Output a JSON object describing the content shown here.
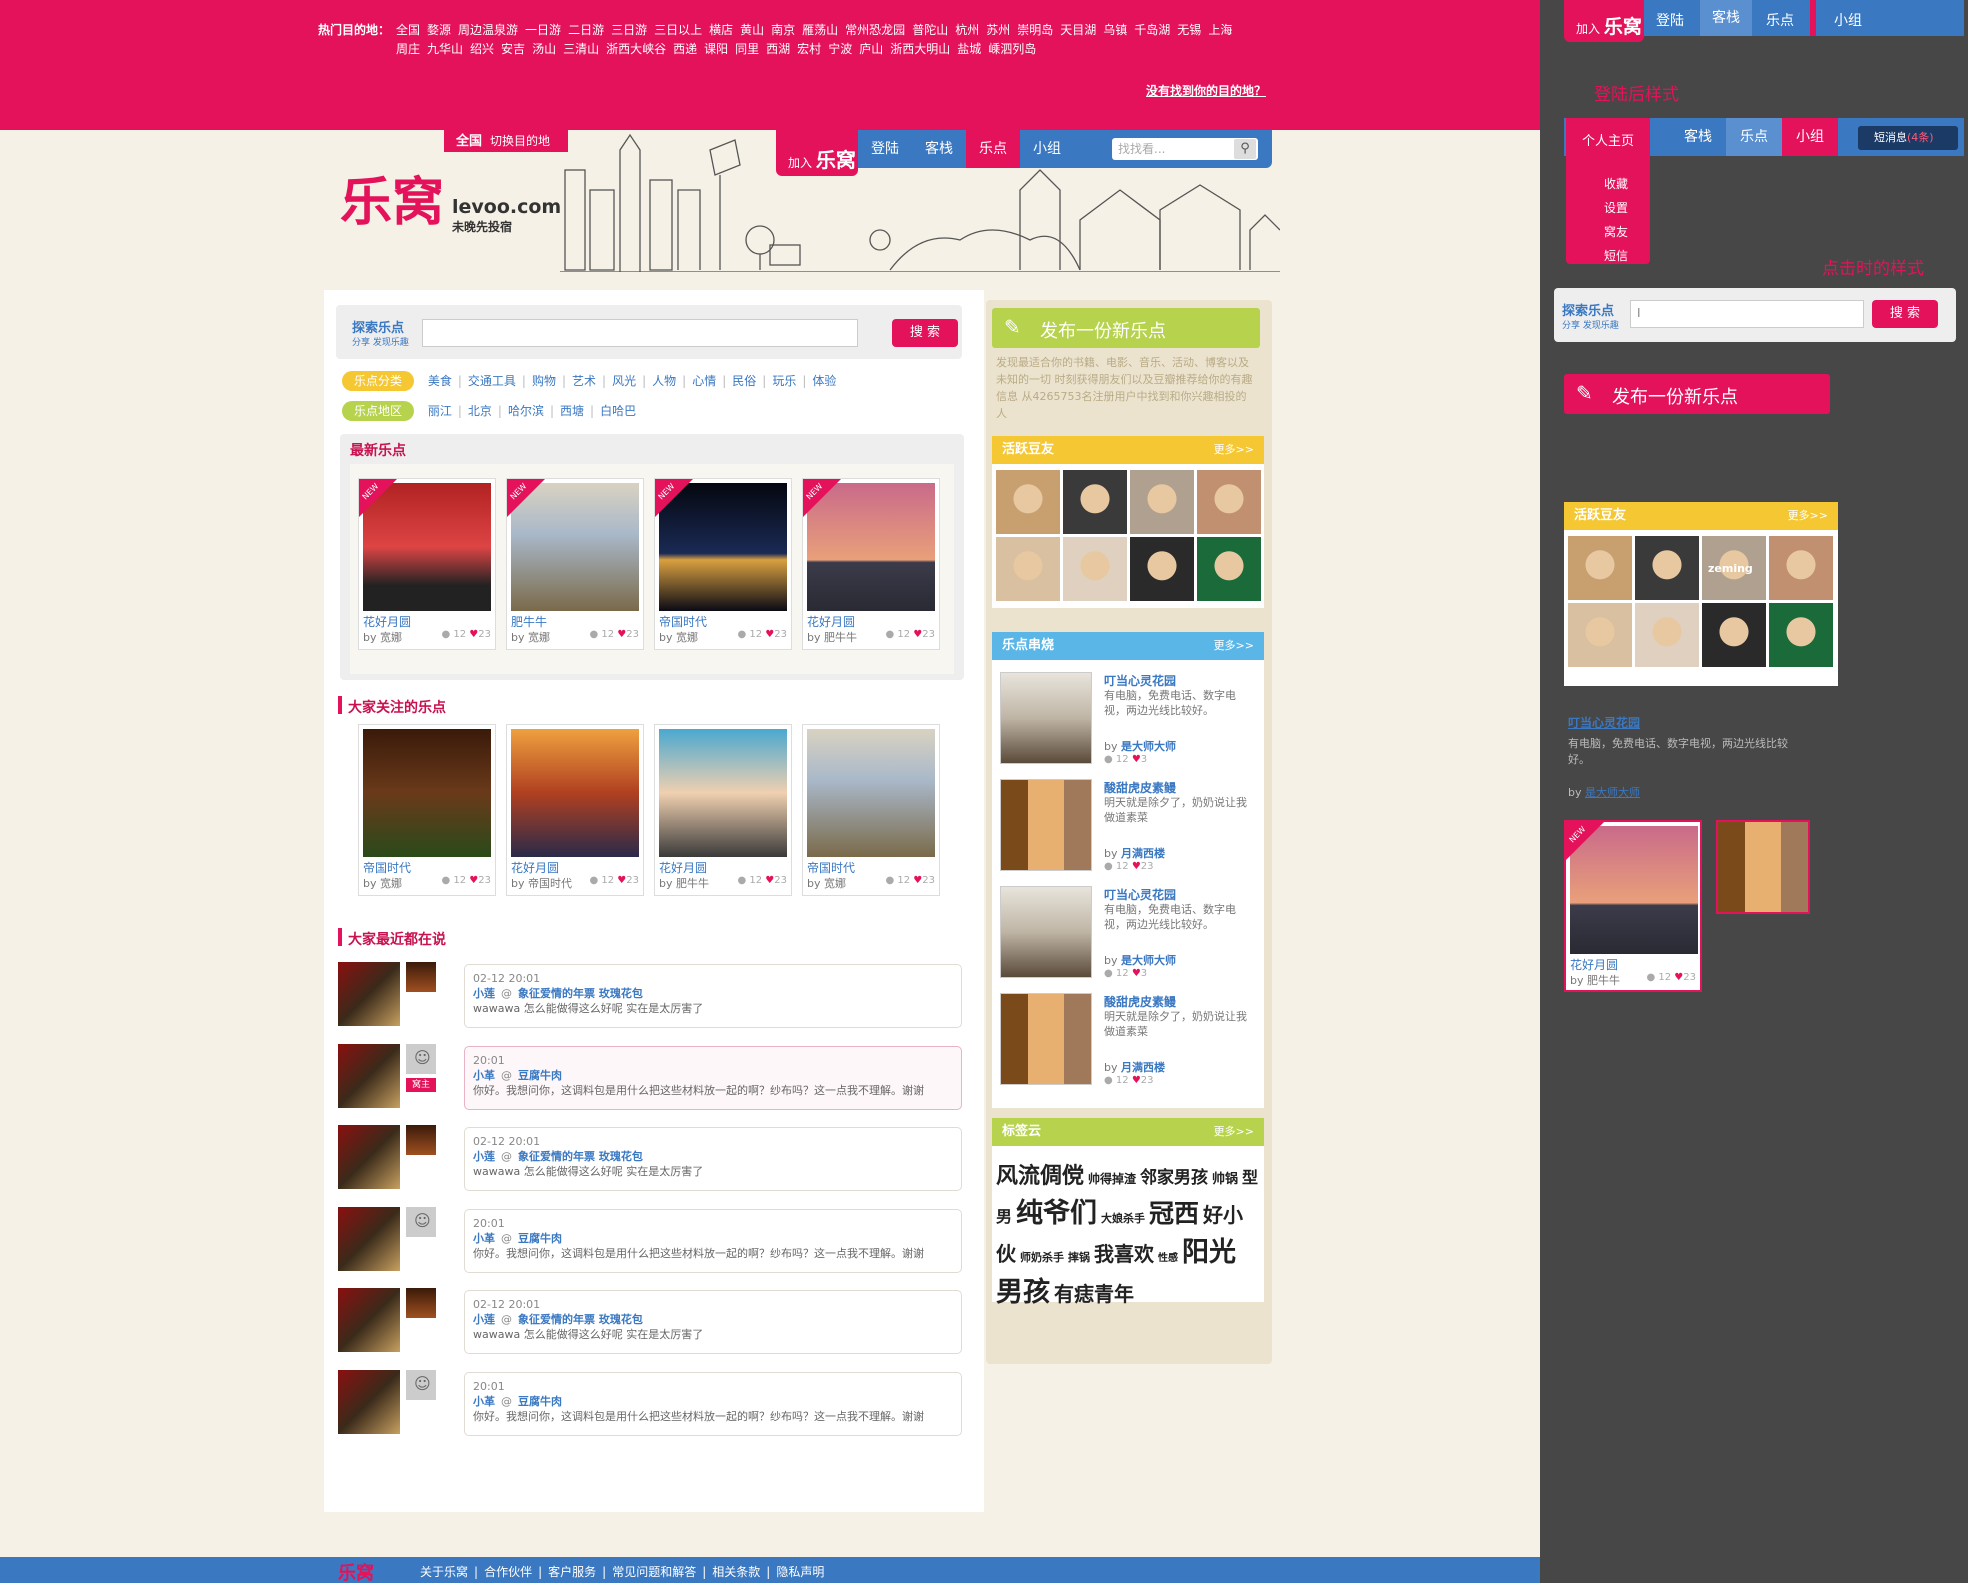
{
  "hot": {
    "label": "热门目的地：",
    "items": [
      "全国",
      "婺源",
      "周边温泉游",
      "一日游",
      "二日游",
      "三日游",
      "三日以上",
      "横店",
      "黄山",
      "南京",
      "雁荡山",
      "常州恐龙园",
      "普陀山",
      "杭州",
      "苏州",
      "崇明岛",
      "天目湖",
      "乌镇",
      "千岛湖",
      "无锡",
      "上海",
      "周庄",
      "九华山",
      "绍兴",
      "安吉",
      "汤山",
      "三清山",
      "浙西大峡谷",
      "西递",
      "课阳",
      "同里",
      "西湖",
      "宏村",
      "宁波",
      "庐山",
      "浙西大明山",
      "盐城",
      "嵊泗列岛"
    ],
    "not_found": "没有找到你的目的地？"
  },
  "city": {
    "name": "全国",
    "switch": "切换目的地"
  },
  "nav": {
    "join": "加入",
    "brand": "乐窝",
    "items": [
      "登陆",
      "客栈",
      "乐点",
      "小组"
    ],
    "search_placeholder": "找找看..."
  },
  "logo": {
    "mark": "乐窝",
    "domain": "levoo.com",
    "slogan": "未晚先投宿"
  },
  "search": {
    "title": "探索乐点",
    "sub": "分享 发现乐趣",
    "button": "搜 索"
  },
  "tags": {
    "cat_label": "乐点分类",
    "cats": [
      "美食",
      "交通工具",
      "购物",
      "艺术",
      "风光",
      "人物",
      "心情",
      "民俗",
      "玩乐",
      "体验"
    ],
    "area_label": "乐点地区",
    "areas": [
      "丽江",
      "北京",
      "哈尔滨",
      "西塘",
      "白哈巴"
    ]
  },
  "latest": {
    "title": "最新乐点",
    "new_label": "NEW",
    "items": [
      {
        "title": "花好月圆",
        "by": "by  宽娜",
        "comments": "12",
        "likes": "23"
      },
      {
        "title": "肥牛牛",
        "by": "by  宽娜",
        "comments": "12",
        "likes": "23"
      },
      {
        "title": "帝国时代",
        "by": "by  宽娜",
        "comments": "12",
        "likes": "23"
      },
      {
        "title": "花好月圆",
        "by": "by  肥牛牛",
        "comments": "12",
        "likes": "23"
      }
    ]
  },
  "focus": {
    "title": "大家关注的乐点",
    "items": [
      {
        "title": "帝国时代",
        "by": "by  宽娜",
        "comments": "12",
        "likes": "23"
      },
      {
        "title": "花好月圆",
        "by": "by  帝国时代",
        "comments": "12",
        "likes": "23"
      },
      {
        "title": "花好月圆",
        "by": "by  肥牛牛",
        "comments": "12",
        "likes": "23"
      },
      {
        "title": "帝国时代",
        "by": "by  宽娜",
        "comments": "12",
        "likes": "23"
      }
    ]
  },
  "talks": {
    "title": "大家最近都在说",
    "owner_badge": "窝主",
    "items": [
      {
        "time": "02-12  20:01",
        "who": "小莲",
        "at": "@",
        "target": "象征爱情的年票  玫瑰花包",
        "text": "wawawa   怎么能做得这么好呢  实在是太厉害了"
      },
      {
        "time": "20:01",
        "who": "小革",
        "at": "@",
        "target": "豆腐牛肉",
        "text": "你好。我想问你，这调料包是用什么把这些材料放一起的啊？纱布吗？这一点我不理解。谢谢"
      },
      {
        "time": "02-12  20:01",
        "who": "小莲",
        "at": "@",
        "target": "象征爱情的年票  玫瑰花包",
        "text": "wawawa   怎么能做得这么好呢  实在是太厉害了"
      },
      {
        "time": "20:01",
        "who": "小革",
        "at": "@",
        "target": "豆腐牛肉",
        "text": "你好。我想问你，这调料包是用什么把这些材料放一起的啊？纱布吗？这一点我不理解。谢谢"
      },
      {
        "time": "02-12  20:01",
        "who": "小莲",
        "at": "@",
        "target": "象征爱情的年票  玫瑰花包",
        "text": "wawawa   怎么能做得这么好呢  实在是太厉害了"
      },
      {
        "time": "20:01",
        "who": "小革",
        "at": "@",
        "target": "豆腐牛肉",
        "text": "你好。我想问你，这调料包是用什么把这些材料放一起的啊？纱布吗？这一点我不理解。谢谢"
      }
    ]
  },
  "publish": {
    "button": "发布一份新乐点",
    "desc": "发现最适合你的书籍、电影、音乐、活动、博客以及未知的一切  时刻获得朋友们以及豆瓣推荐给你的有趣信息  从4265753名注册用户中找到和你兴趣相投的人"
  },
  "active": {
    "title": "活跃豆友",
    "more": "更多>>"
  },
  "hot_points": {
    "title": "乐点串烧",
    "more": "更多>>",
    "items": [
      {
        "title": "叮当心灵花园",
        "desc": "有电脑，免费电话、数字电视，两边光线比较好。",
        "by": "by",
        "author": "是大师大师",
        "comments": "12",
        "likes": "3"
      },
      {
        "title": "酸甜虎皮素鳗",
        "desc": "明天就是除夕了，奶奶说让我做道素菜",
        "by": "by",
        "author": "月满西楼",
        "comments": "12",
        "likes": "23"
      },
      {
        "title": "叮当心灵花园",
        "desc": "有电脑，免费电话、数字电视，两边光线比较好。",
        "by": "by",
        "author": "是大师大师",
        "comments": "12",
        "likes": "3"
      },
      {
        "title": "酸甜虎皮素鳗",
        "desc": "明天就是除夕了，奶奶说让我做道素菜",
        "by": "by",
        "author": "月满西楼",
        "comments": "12",
        "likes": "23"
      }
    ]
  },
  "tagcloud": {
    "title": "标签云",
    "more": "更多>>",
    "tags": [
      {
        "t": "风流倜傥",
        "s": 22
      },
      {
        "t": "帅得掉渣",
        "s": 12
      },
      {
        "t": "邻家男孩",
        "s": 17
      },
      {
        "t": "帅锅",
        "s": 13
      },
      {
        "t": "型男",
        "s": 16
      },
      {
        "t": "纯爷们",
        "s": 27
      },
      {
        "t": "大娘杀手",
        "s": 11
      },
      {
        "t": "冠西",
        "s": 25
      },
      {
        "t": "好小伙",
        "s": 20
      },
      {
        "t": "师奶杀手",
        "s": 11
      },
      {
        "t": "摔锅",
        "s": 11
      },
      {
        "t": "我喜欢",
        "s": 20
      },
      {
        "t": "性感",
        "s": 10
      },
      {
        "t": "阳光男孩",
        "s": 27
      },
      {
        "t": "有痣青年",
        "s": 20
      }
    ]
  },
  "footer": {
    "logo": "乐窝",
    "links": [
      "关于乐窝",
      "合作伙伴",
      "客户服务",
      "常见问题和解答",
      "相关条款",
      "隐私声明"
    ]
  },
  "side": {
    "nav_join": "加入",
    "nav_brand": "乐窝",
    "nav_items": [
      "登陆",
      "客栈",
      "乐点",
      "小组"
    ],
    "login_note": "登陆后样式",
    "menu_home": "个人主页",
    "menu_items": [
      "客栈",
      "乐点",
      "小组"
    ],
    "msg": "短消息",
    "msg_count": "(4条)",
    "drop": [
      "收藏",
      "设置",
      "窝友",
      "短信"
    ],
    "click_note": "点击时的样式",
    "search_title": "探索乐点",
    "search_sub": "分享 发现乐趣",
    "search_btn": "搜 索",
    "publish": "发布一份新乐点",
    "active_title": "活跃豆友",
    "active_more": "更多>>",
    "face_label": "zeming",
    "hover_title": "叮当心灵花园",
    "hover_desc": "有电脑，免费电话、数字电视，两边光线比较好。",
    "hover_by": "by",
    "hover_author": "是大师大师",
    "photo_title": "花好月圆",
    "photo_by": "by  肥牛牛",
    "photo_comments": "12",
    "photo_likes": "23",
    "new_label": "NEW"
  },
  "colors": {
    "pink": "#e4125a",
    "blue": "#3a78c2",
    "green": "#b7d34e",
    "yellow": "#f4c733",
    "sky": "#5bb6e8"
  }
}
